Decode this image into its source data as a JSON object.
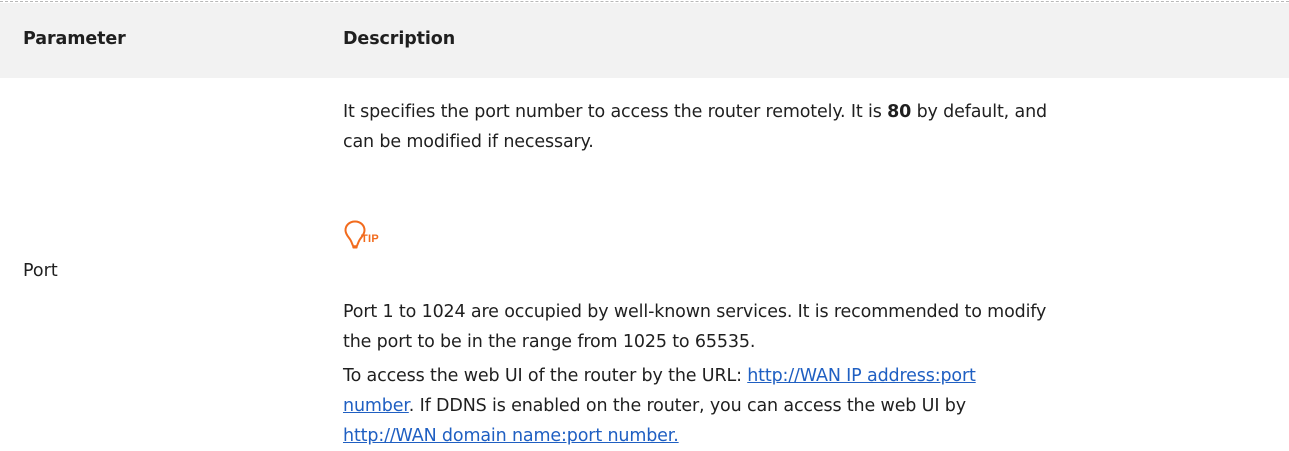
{
  "table": {
    "header": {
      "parameter": "Parameter",
      "description": "Description"
    },
    "row": {
      "parameter": "Port",
      "p1": {
        "line1_before": "It specifies the port number to access the router remotely. It is ",
        "line1_bold": "80",
        "line1_after": " by default, and",
        "line2": "can be modified if necessary."
      },
      "tip_label": "TIP",
      "p2": {
        "line1": "Port 1 to 1024 are occupied by well-known services. It is recommended to modify",
        "line2": "the port to be in the range from 1025 to 65535."
      },
      "p3": {
        "line1_before": "To access the web UI of the router by the URL: ",
        "link1_part1": "http://WAN IP address:port",
        "link1_part2": "number",
        "line2_after": ". If DDNS is enabled on the router, you can access the web UI by",
        "link2": "http://WAN domain name:port number."
      }
    }
  },
  "colors": {
    "header_bg": "#f2f2f2",
    "link": "#1f5fc2",
    "tip_accent": "#f26b1d",
    "text": "#1f1f1f"
  },
  "icons": {
    "tip": "lightbulb-icon"
  }
}
